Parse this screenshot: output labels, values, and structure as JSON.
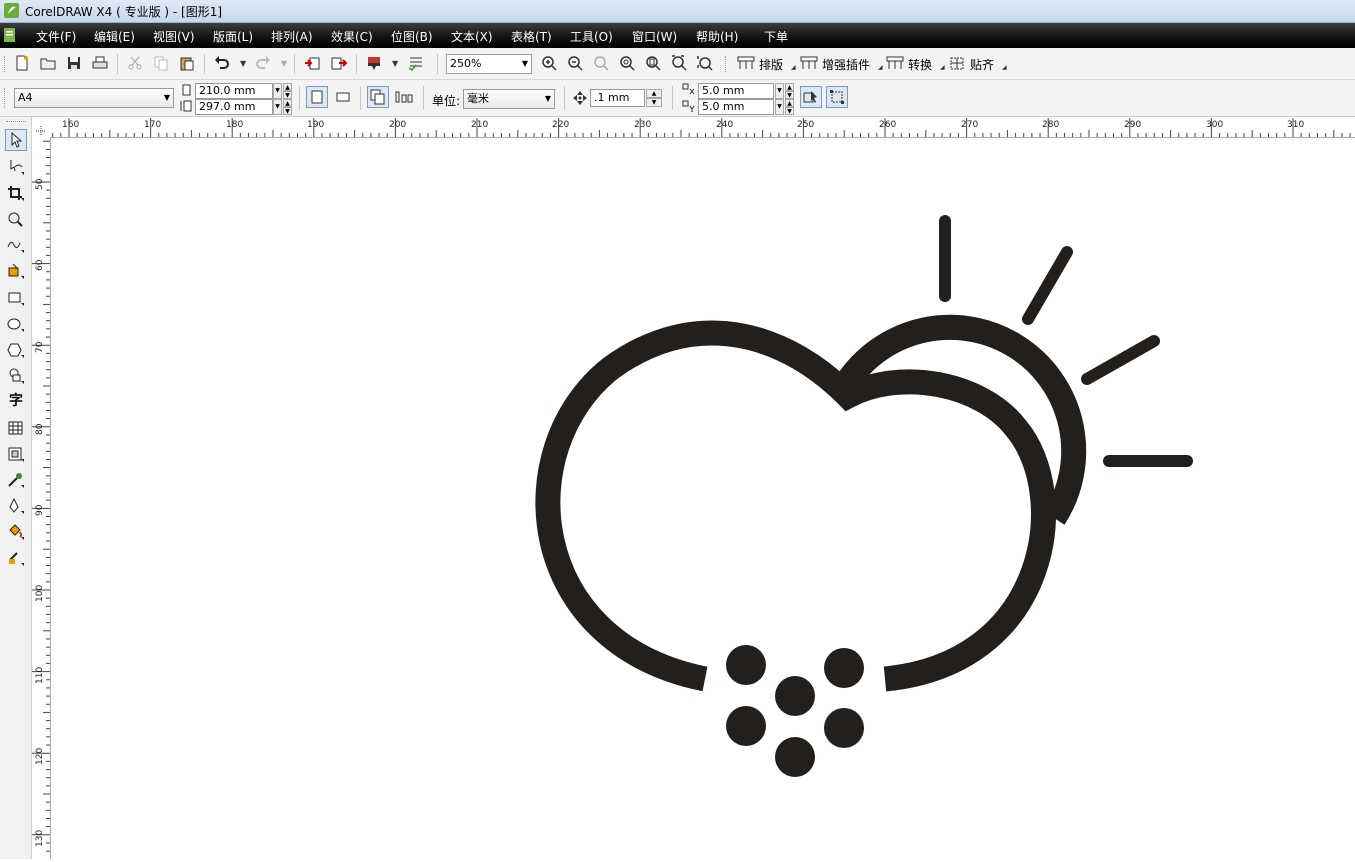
{
  "window": {
    "title": "CorelDRAW X4 ( 专业版 ) - [图形1]"
  },
  "menu": [
    {
      "label": "文件(F)"
    },
    {
      "label": "编辑(E)"
    },
    {
      "label": "视图(V)"
    },
    {
      "label": "版面(L)"
    },
    {
      "label": "排列(A)"
    },
    {
      "label": "效果(C)"
    },
    {
      "label": "位图(B)"
    },
    {
      "label": "文本(X)"
    },
    {
      "label": "表格(T)"
    },
    {
      "label": "工具(O)"
    },
    {
      "label": "窗口(W)"
    },
    {
      "label": "帮助(H)"
    },
    {
      "label": "下单"
    }
  ],
  "toolbar": {
    "zoom_value": "250%",
    "plugins": [
      {
        "label": "排版",
        "icon": "layout-icon"
      },
      {
        "label": "增强插件",
        "icon": "plugin-icon"
      },
      {
        "label": "转换",
        "icon": "convert-icon"
      },
      {
        "label": "贴齐",
        "icon": "snap-icon"
      }
    ]
  },
  "property_bar": {
    "page_size": "A4",
    "width": "210.0 mm",
    "height": "297.0 mm",
    "unit_label": "单位:",
    "unit_value": "毫米",
    "nudge": ".1 mm",
    "dup_x": "5.0 mm",
    "dup_y": "5.0 mm"
  },
  "rulers": {
    "horizontal": [
      "160",
      "170",
      "180",
      "190",
      "200",
      "210",
      "220",
      "230",
      "240",
      "250",
      "260",
      "270",
      "280",
      "290",
      "300",
      "310"
    ],
    "vertical": [
      "50",
      "60",
      "70",
      "80",
      "90",
      "100",
      "110",
      "120",
      "130"
    ]
  },
  "tools": [
    "pick-tool-icon",
    "shape-tool-icon",
    "crop-tool-icon",
    "zoom-tool-icon",
    "freehand-tool-icon",
    "smart-fill-icon",
    "rectangle-tool-icon",
    "ellipse-tool-icon",
    "polygon-tool-icon",
    "basic-shapes-icon",
    "text-tool-icon",
    "table-tool-icon",
    "interactive-tool-icon",
    "eyedropper-icon",
    "outline-tool-icon",
    "fill-tool-icon",
    "interactive-fill-icon"
  ],
  "colors": {
    "artwork": "#231f1c",
    "menubar": "#000000",
    "accent": "#7a9cc4"
  }
}
